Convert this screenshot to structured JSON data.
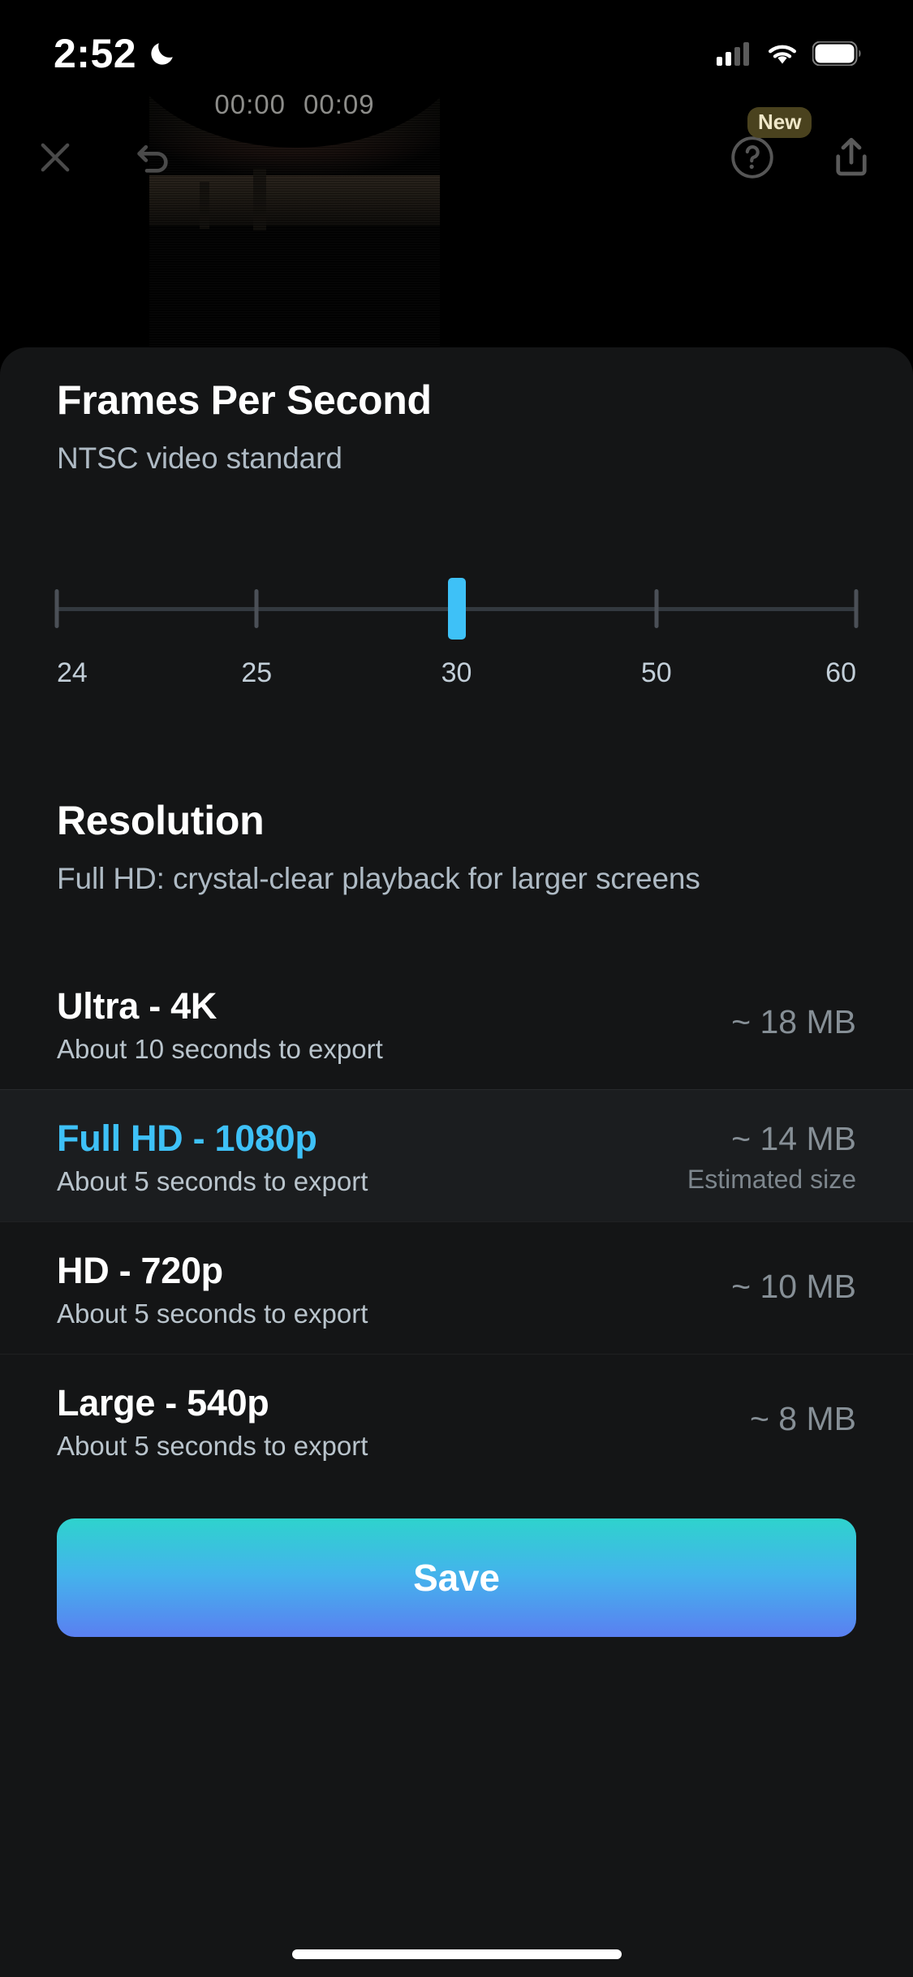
{
  "status_bar": {
    "time": "2:52",
    "dnd_icon": "moon-icon",
    "signal_icon": "cellular-signal-icon",
    "wifi_icon": "wifi-icon",
    "battery_icon": "battery-icon"
  },
  "toolbar": {
    "close_icon": "close-icon",
    "undo_icon": "undo-icon",
    "help_icon": "help-question-icon",
    "help_badge": "New",
    "share_icon": "share-upload-icon"
  },
  "preview": {
    "current_time": "00:00",
    "total_time": "00:09"
  },
  "fps": {
    "title": "Frames Per Second",
    "subtitle": "NTSC video standard",
    "selected": "30",
    "ticks": [
      "24",
      "25",
      "30",
      "50",
      "60"
    ]
  },
  "resolution": {
    "title": "Resolution",
    "subtitle": "Full HD: crystal-clear playback for larger screens",
    "options": [
      {
        "name": "Ultra - 4K",
        "desc": "About 10 seconds to export",
        "size": "~ 18 MB",
        "note": "",
        "selected": false
      },
      {
        "name": "Full HD - 1080p",
        "desc": "About 5 seconds to export",
        "size": "~ 14 MB",
        "note": "Estimated size",
        "selected": true
      },
      {
        "name": "HD - 720p",
        "desc": "About 5 seconds to export",
        "size": "~ 10 MB",
        "note": "",
        "selected": false
      },
      {
        "name": "Large - 540p",
        "desc": "About 5 seconds to export",
        "size": "~ 8 MB",
        "note": "",
        "selected": false
      }
    ]
  },
  "actions": {
    "save_label": "Save"
  },
  "colors": {
    "accent_blue": "#3ec1f7",
    "sheet_bg": "#141516",
    "selected_row_bg": "#1b1d1f",
    "save_gradient_start": "#2ed3cd",
    "save_gradient_end": "#5a7ff1",
    "subtitle_text": "#aebac4"
  }
}
